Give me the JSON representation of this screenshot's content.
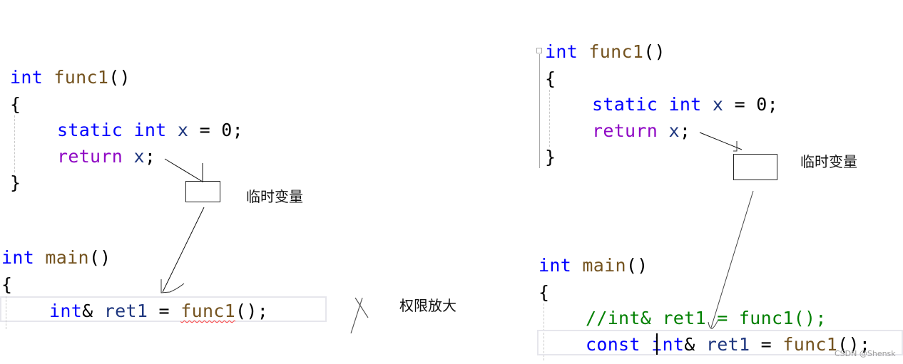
{
  "left": {
    "func1": {
      "sig_type": "int",
      "sig_name": "func1",
      "sig_parens": "()",
      "open_brace": "{",
      "line1_static": "static",
      "line1_int": "int",
      "line1_var": "x",
      "line1_rest": " = 0;",
      "line2_return": "return",
      "line2_var": "x",
      "line2_semi": ";",
      "close_brace": "}"
    },
    "main": {
      "sig_type": "int",
      "sig_name": "main",
      "sig_parens": "()",
      "open_brace": "{",
      "line1_type": "int",
      "line1_amp": "&",
      "line1_var": "ret1",
      "line1_eq": " = ",
      "line1_call": "func1",
      "line1_end": "();"
    },
    "temp_label": "临时变量",
    "error_label": "权限放大"
  },
  "right": {
    "func1": {
      "sig_type": "int",
      "sig_name": "func1",
      "sig_parens": "()",
      "open_brace": "{",
      "line1_static": "static",
      "line1_int": "int",
      "line1_var": "x",
      "line1_rest": " = 0;",
      "line2_return": "return",
      "line2_var": "x",
      "line2_semi": ";",
      "close_brace": "}"
    },
    "main": {
      "sig_type": "int",
      "sig_name": "main",
      "sig_parens": "()",
      "open_brace": "{",
      "comment_line": "//int& ret1 = func1();",
      "line2_const": "const",
      "line2_type": "int",
      "line2_amp": "&",
      "line2_var": "ret1",
      "line2_eq": " = ",
      "line2_call": "func1",
      "line2_end": "();"
    },
    "temp_label": "临时变量"
  },
  "watermark": "CSDN @Shensk"
}
